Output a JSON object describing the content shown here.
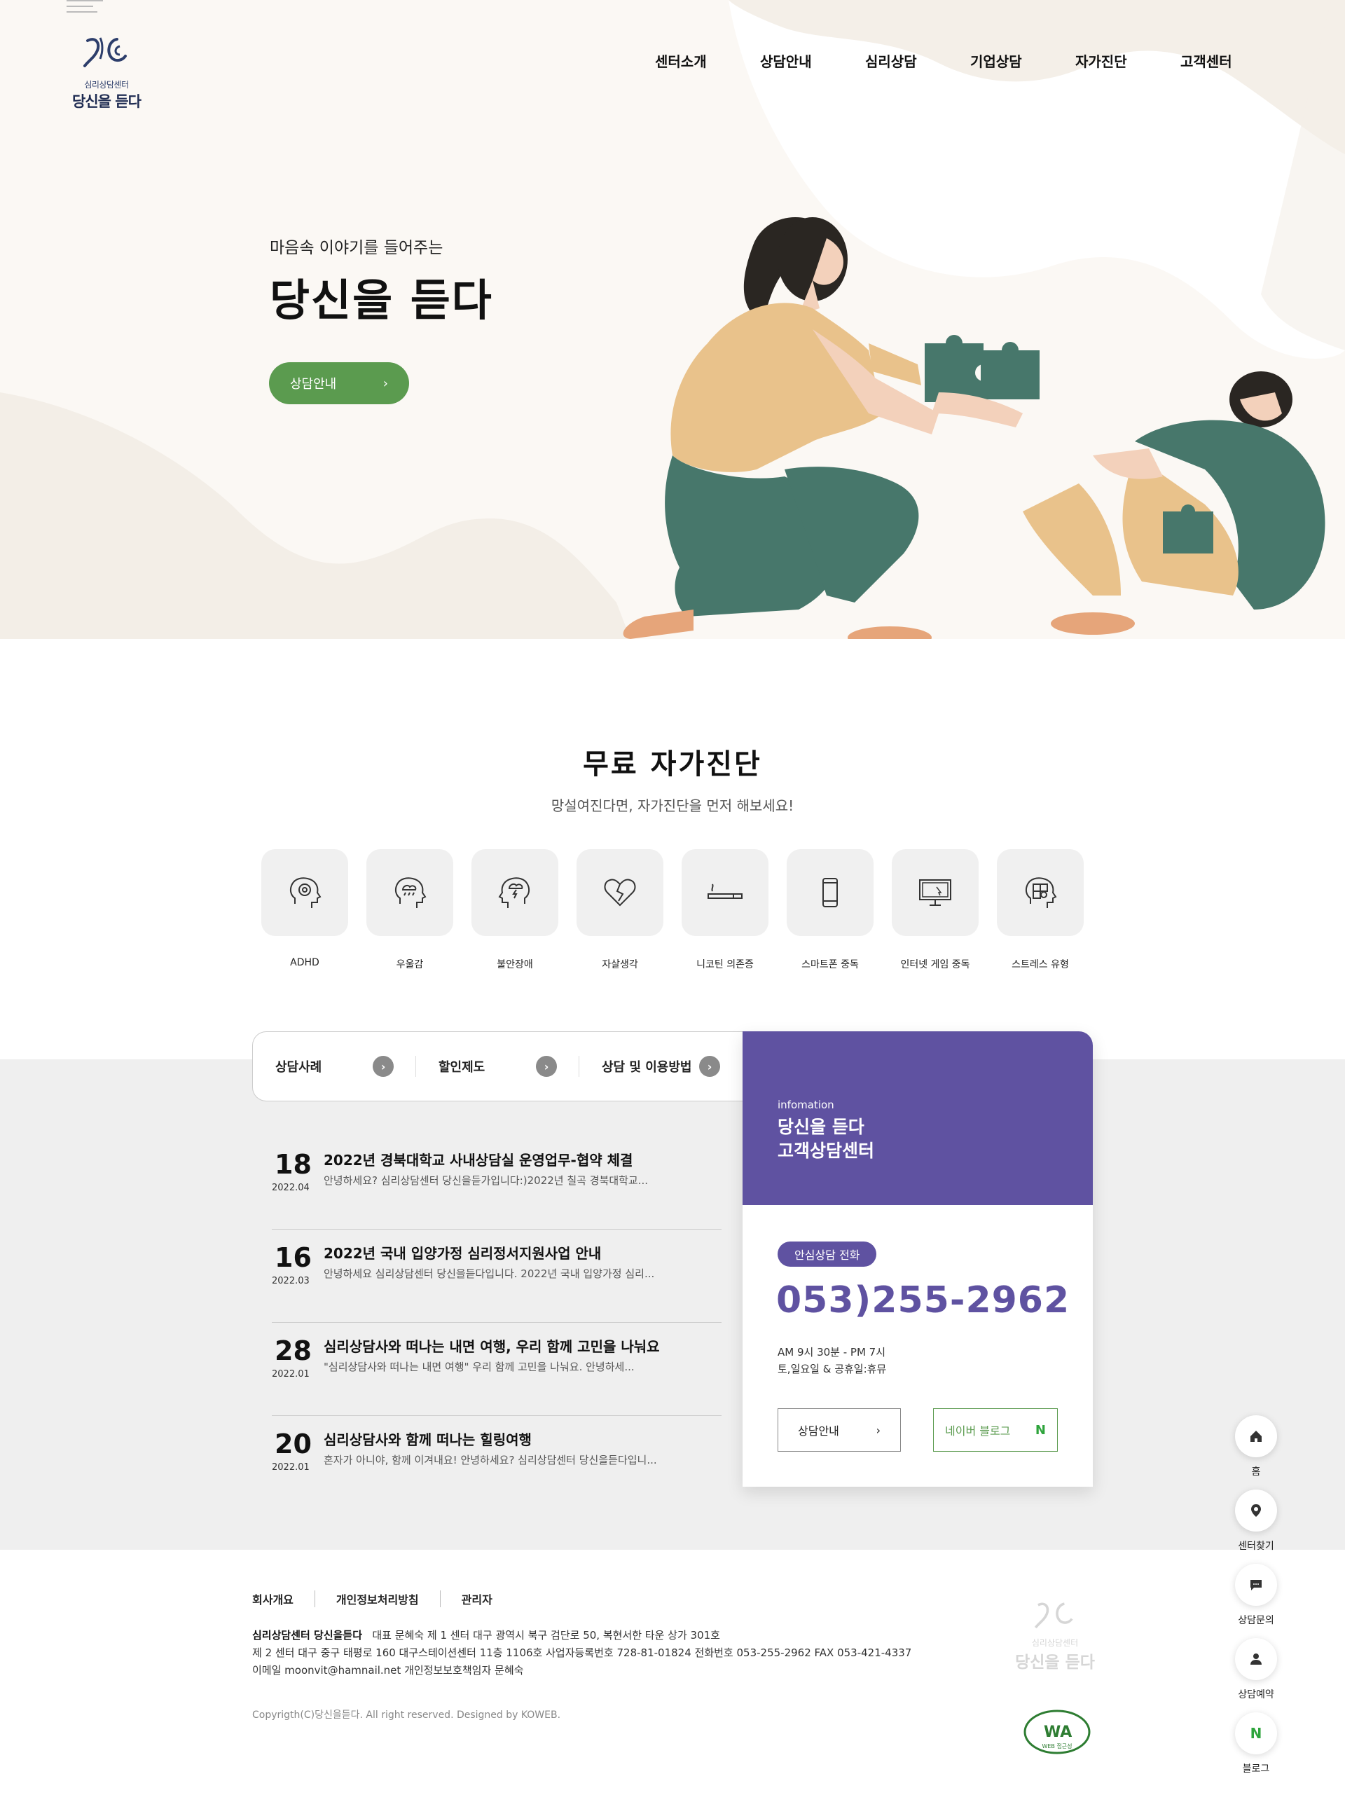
{
  "header": {
    "logo_sub": "심리상담센터",
    "logo_main": "당신을 듣다",
    "nav": [
      "센터소개",
      "상담안내",
      "심리상담",
      "기업상담",
      "자가진단",
      "고객센터"
    ]
  },
  "hero": {
    "subtitle": "마음속 이야기를 들어주는",
    "title": "당신을 듣다",
    "button": "상담안내",
    "button_arrow": "›"
  },
  "self_diagnosis": {
    "title": "무료 자가진단",
    "subtitle": "망설여진다면, 자가진단을 먼저 해보세요!",
    "items": [
      {
        "label": "ADHD",
        "icon": "head-spiral-icon"
      },
      {
        "label": "우울감",
        "icon": "head-rain-cloud-icon"
      },
      {
        "label": "불안장애",
        "icon": "head-storm-icon"
      },
      {
        "label": "자살생각",
        "icon": "broken-heart-icon"
      },
      {
        "label": "니코틴 의존증",
        "icon": "cigarette-icon"
      },
      {
        "label": "스마트폰 중독",
        "icon": "smartphone-icon"
      },
      {
        "label": "인터넷 게임 중독",
        "icon": "monitor-icon"
      },
      {
        "label": "스트레스 유형",
        "icon": "head-puzzle-icon"
      }
    ]
  },
  "tabs": [
    {
      "label": "상담사례",
      "arrow": "›"
    },
    {
      "label": "할인제도",
      "arrow": "›"
    },
    {
      "label": "상담 및 이용방법",
      "arrow": "›"
    }
  ],
  "news": [
    {
      "day": "18",
      "ym": "2022.04",
      "title": "2022년 경북대학교 사내상담실 운영업무-협약 체결",
      "excerpt": "안녕하세요? 심리상담센터 당신을듣가입니다:)2022년 칠곡 경북대학교..."
    },
    {
      "day": "16",
      "ym": "2022.03",
      "title": "2022년 국내 입양가정 심리정서지원사업 안내",
      "excerpt": "안녕하세요 심리상담센터 당신을듣다입니다. 2022년 국내 입양가정 심리..."
    },
    {
      "day": "28",
      "ym": "2022.01",
      "title": "심리상담사와 떠나는 내면 여행, 우리 함께 고민을 나눠요",
      "excerpt": "\"심리상담사와 떠나는 내면 여행\" 우리 함께 고민을 나눠요. 안녕하세..."
    },
    {
      "day": "20",
      "ym": "2022.01",
      "title": "심리상담사와 함께 떠나는 힐링여행",
      "excerpt": "혼자가 아니야, 함께 이겨내요! 안녕하세요? 심리상담센터 당신을듣다입니..."
    }
  ],
  "info": {
    "label_en": "infomation",
    "title_line1": "당신을 듣다",
    "title_line2": "고객상담센터",
    "pill": "안심상담 전화",
    "phone": "053)255-2962",
    "hours_line1": "AM 9시 30분 - PM 7시",
    "hours_line2": "토,일요일 & 공휴일:휴뮤",
    "button1": "상담안내",
    "button1_arrow": "›",
    "button2": "네이버 블로그",
    "button2_mark": "N",
    "accent_color": "#5f52a1",
    "green_color": "#5b9b4f"
  },
  "quick_menu": [
    {
      "label": "홈",
      "icon": "home-icon"
    },
    {
      "label": "센터찾기",
      "icon": "location-pin-icon"
    },
    {
      "label": "상담문의",
      "icon": "chat-bubble-icon"
    },
    {
      "label": "상담예약",
      "icon": "user-icon"
    },
    {
      "label": "블로그",
      "icon": "naver-n-icon"
    }
  ],
  "footer": {
    "links": [
      "회사개요",
      "개인정보처리방침",
      "관리자"
    ],
    "company": "심리상담센터 당신을듣다",
    "line1_rest": "대표 문혜숙   제 1 센터 대구 광역시 북구 검단로 50, 복현서한 타운 상가 301호",
    "line2": "제 2 센터 대구 중구 태평로 160 대구스테이션센터 11층 1106호 사업자등록번호 728-81-01824   전화번호 053-255-2962    FAX 053-421-4337",
    "line3": "이메일 moonvit@hamnail.net    개인정보보호책임자 문혜숙",
    "copyright": "Copyrigth(C)당신을듣다. All right reserved. Designed by KOWEB.",
    "logo_sub": "심리상담센터",
    "logo_main": "당신을 듣다",
    "wa_mark": "WA",
    "wa_text": "WEB 접근성"
  }
}
